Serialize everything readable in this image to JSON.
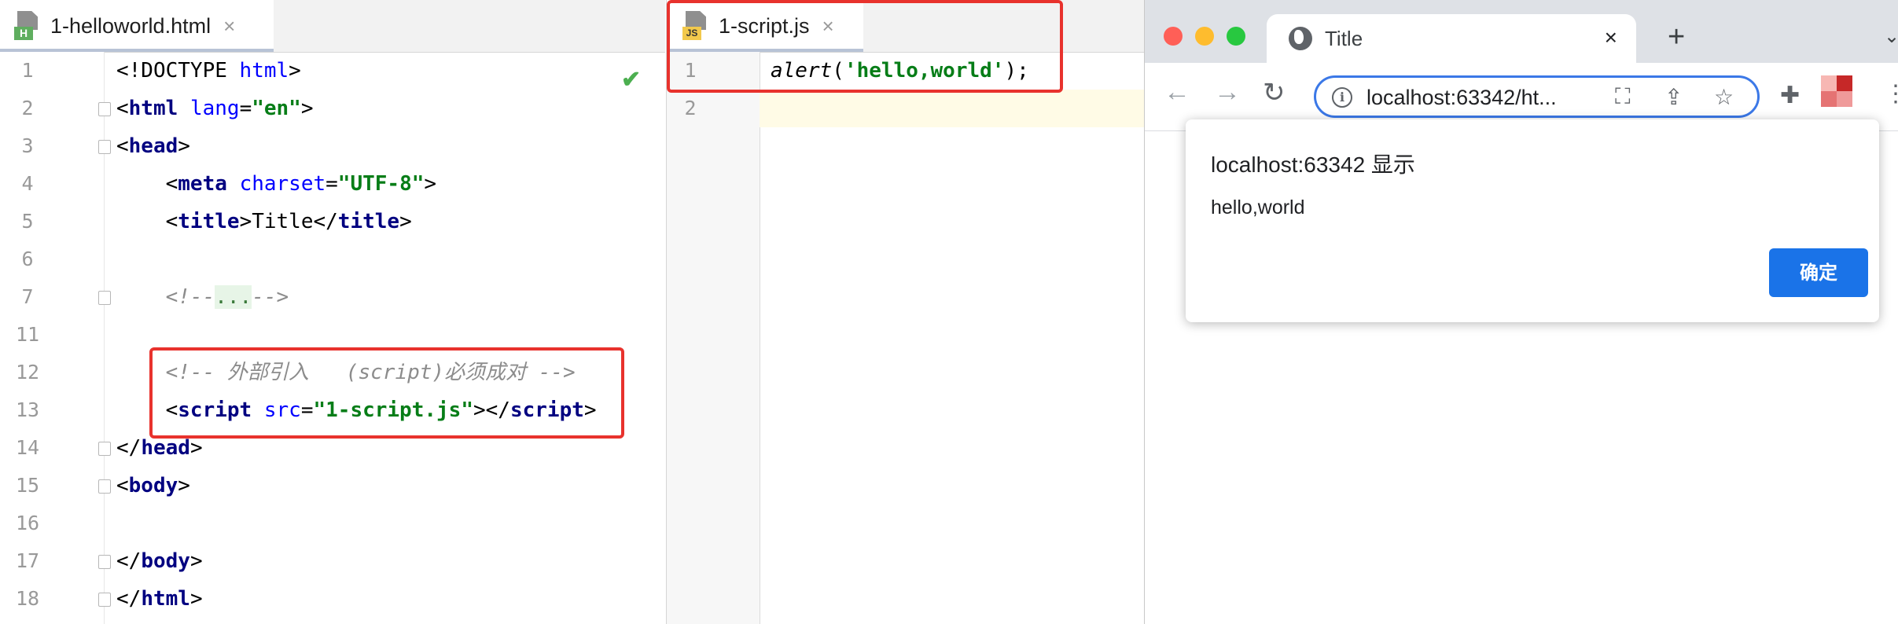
{
  "html_editor": {
    "tab_label": "1-helloworld.html",
    "tab_close": "×",
    "file_badge": "H",
    "code_lines": [
      {
        "num": "1",
        "segments": [
          {
            "t": "<!DOCTYPE ",
            "c": "plain"
          },
          {
            "t": "html",
            "c": "attr"
          },
          {
            "t": ">",
            "c": "plain"
          }
        ]
      },
      {
        "num": "2",
        "segments": [
          {
            "t": "<",
            "c": "punct"
          },
          {
            "t": "html",
            "c": "tag"
          },
          {
            "t": " ",
            "c": "plain"
          },
          {
            "t": "lang",
            "c": "attr"
          },
          {
            "t": "=",
            "c": "punct"
          },
          {
            "t": "\"en\"",
            "c": "str"
          },
          {
            "t": ">",
            "c": "punct"
          }
        ]
      },
      {
        "num": "3",
        "segments": [
          {
            "t": "<",
            "c": "punct"
          },
          {
            "t": "head",
            "c": "tag"
          },
          {
            "t": ">",
            "c": "punct"
          }
        ]
      },
      {
        "num": "4",
        "segments": [
          {
            "t": "    <",
            "c": "punct"
          },
          {
            "t": "meta",
            "c": "tag"
          },
          {
            "t": " ",
            "c": "plain"
          },
          {
            "t": "charset",
            "c": "attr"
          },
          {
            "t": "=",
            "c": "punct"
          },
          {
            "t": "\"UTF-8\"",
            "c": "str"
          },
          {
            "t": ">",
            "c": "punct"
          }
        ]
      },
      {
        "num": "5",
        "segments": [
          {
            "t": "    <",
            "c": "punct"
          },
          {
            "t": "title",
            "c": "tag"
          },
          {
            "t": ">Title</",
            "c": "plain"
          },
          {
            "t": "title",
            "c": "tag"
          },
          {
            "t": ">",
            "c": "punct"
          }
        ]
      },
      {
        "num": "6",
        "segments": []
      },
      {
        "num": "7",
        "segments": [
          {
            "t": "    <!--",
            "c": "cmt"
          },
          {
            "t": "...",
            "c": "collapsed"
          },
          {
            "t": "-->",
            "c": "cmt"
          }
        ]
      },
      {
        "num": "11",
        "segments": []
      },
      {
        "num": "12",
        "segments": [
          {
            "t": "    <!-- 外部引入   (script)必须成对 -->",
            "c": "cmt"
          }
        ]
      },
      {
        "num": "13",
        "segments": [
          {
            "t": "    <",
            "c": "punct"
          },
          {
            "t": "script",
            "c": "tag"
          },
          {
            "t": " ",
            "c": "plain"
          },
          {
            "t": "src",
            "c": "attr"
          },
          {
            "t": "=",
            "c": "punct"
          },
          {
            "t": "\"1-script.js\"",
            "c": "str"
          },
          {
            "t": "></",
            "c": "punct"
          },
          {
            "t": "script",
            "c": "tag"
          },
          {
            "t": ">",
            "c": "punct"
          }
        ]
      },
      {
        "num": "14",
        "segments": [
          {
            "t": "</",
            "c": "punct"
          },
          {
            "t": "head",
            "c": "tag"
          },
          {
            "t": ">",
            "c": "punct"
          }
        ]
      },
      {
        "num": "15",
        "segments": [
          {
            "t": "<",
            "c": "punct"
          },
          {
            "t": "body",
            "c": "tag"
          },
          {
            "t": ">",
            "c": "punct"
          }
        ]
      },
      {
        "num": "16",
        "segments": []
      },
      {
        "num": "17",
        "segments": [
          {
            "t": "</",
            "c": "punct"
          },
          {
            "t": "body",
            "c": "tag"
          },
          {
            "t": ">",
            "c": "punct"
          }
        ]
      },
      {
        "num": "18",
        "segments": [
          {
            "t": "</",
            "c": "punct"
          },
          {
            "t": "html",
            "c": "tag"
          },
          {
            "t": ">",
            "c": "punct"
          }
        ]
      }
    ],
    "check_mark": "✔"
  },
  "js_editor": {
    "tab_label": "1-script.js",
    "tab_close": "×",
    "file_badge": "JS",
    "code_lines": [
      {
        "num": "1",
        "segments": [
          {
            "t": "alert",
            "c": "js-fn"
          },
          {
            "t": "(",
            "c": "plain"
          },
          {
            "t": "'hello,world'",
            "c": "str"
          },
          {
            "t": ");",
            "c": "plain"
          }
        ]
      },
      {
        "num": "2",
        "segments": []
      }
    ]
  },
  "browser": {
    "tab_title": "Title",
    "tab_close": "×",
    "new_tab": "+",
    "tab_menu": "⌄",
    "back": "←",
    "forward": "→",
    "reload": "↻",
    "url": "localhost:63342/ht...",
    "omnibox_icons": {
      "translate": "⛶",
      "share": "⇪",
      "bookmark": "☆"
    },
    "extensions": "✚",
    "kebab": "⋮",
    "dialog": {
      "title": "localhost:63342 显示",
      "message": "hello,world",
      "ok_label": "确定"
    },
    "colors": {
      "accent": "#1a73e8",
      "omnibox_border": "#3b78e7",
      "traffic_red": "#ff5f57",
      "traffic_yellow": "#febc2e",
      "traffic_green": "#28c840"
    }
  },
  "highlight_color": "#e8322d"
}
